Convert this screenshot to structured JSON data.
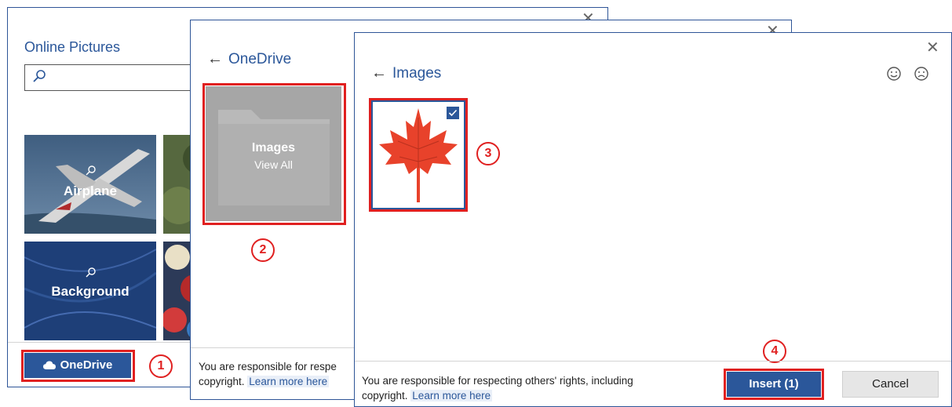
{
  "dialog1": {
    "title": "Online Pictures",
    "search_placeholder": "",
    "tiles": [
      {
        "label": "Airplane"
      },
      {
        "label": "Background"
      }
    ],
    "onedrive_button": "OneDrive"
  },
  "dialog2": {
    "title": "OneDrive",
    "folder": {
      "name": "Images",
      "sub": "View All"
    },
    "footer": {
      "text_a": "You are responsible for respe",
      "text_b": "copyright.",
      "link": "Learn more here"
    }
  },
  "dialog3": {
    "title": "Images",
    "footer": {
      "text_a": "You are responsible for respecting others' rights, including",
      "text_b": "copyright.",
      "link": "Learn more here"
    },
    "insert_button": "Insert (1)",
    "cancel_button": "Cancel"
  },
  "callouts": [
    "1",
    "2",
    "3",
    "4"
  ],
  "colors": {
    "accent": "#2b579a",
    "highlight": "#e02020",
    "folder": "#a6a6a6"
  },
  "icons": [
    "search-icon",
    "close-icon",
    "back-arrow-icon",
    "cloud-icon",
    "smile-icon",
    "frown-icon",
    "check-icon",
    "folder-icon",
    "maple-leaf-image"
  ]
}
